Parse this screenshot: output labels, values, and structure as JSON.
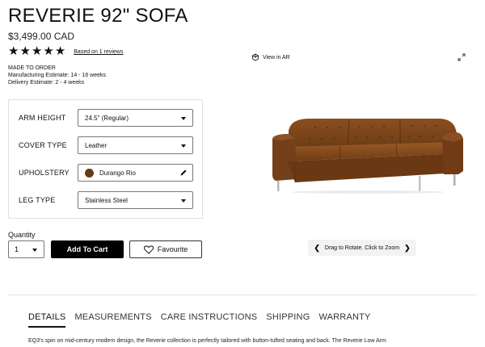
{
  "product": {
    "title": "REVERIE 92\" SOFA",
    "price": "$3,499.00 CAD",
    "rating_stars": 5,
    "reviews_link": "Based on 1 reviews",
    "made_to_order": "MADE TO ORDER",
    "manufacturing_estimate": "Manufacturing Estimate: 14 - 16 weeks",
    "delivery_estimate": "Delivery Estimate: 2 - 4 weeks"
  },
  "options": [
    {
      "label": "ARM HEIGHT",
      "value": "24.5\" (Regular)",
      "control": "dropdown"
    },
    {
      "label": "COVER TYPE",
      "value": "Leather",
      "control": "dropdown"
    },
    {
      "label": "UPHOLSTERY",
      "value": "Durango Rio",
      "control": "edit",
      "swatch_color": "#6b3a12"
    },
    {
      "label": "LEG TYPE",
      "value": "Stainless Steel",
      "control": "dropdown"
    }
  ],
  "purchase": {
    "quantity_label": "Quantity",
    "quantity_value": "1",
    "add_to_cart": "Add To Cart",
    "favourite": "Favourite"
  },
  "viewer": {
    "view_in_ar": "View in AR",
    "rotate_hint": "Drag to Rotate. Click to Zoom"
  },
  "tabs": [
    {
      "label": "DETAILS",
      "active": true
    },
    {
      "label": "MEASUREMENTS",
      "active": false
    },
    {
      "label": "CARE INSTRUCTIONS",
      "active": false
    },
    {
      "label": "SHIPPING",
      "active": false
    },
    {
      "label": "WARRANTY",
      "active": false
    }
  ],
  "description": "EQ3's spin on mid-century modern design, the Reverie collection is perfectly tailored with button-tufted seating and back. The Reverie Low Arm",
  "colors": {
    "accent": "#000000",
    "leather": "#7a4418",
    "panel_border": "#e2e2e2"
  }
}
